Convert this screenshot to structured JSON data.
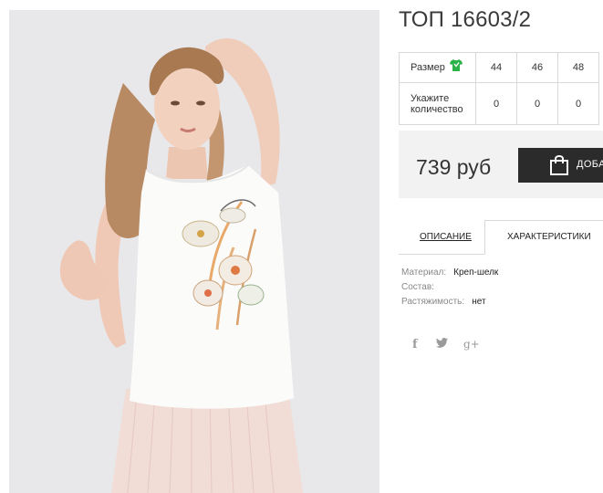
{
  "product": {
    "title": "ТОП 16603/2",
    "image_alt": "Model wearing white sleeveless top with flower print and pink pleated skirt"
  },
  "sizes": {
    "size_label": "Размер",
    "quantity_label_line1": "Укажите",
    "quantity_label_line2": "количество",
    "options": [
      {
        "size": "44",
        "qty": "0"
      },
      {
        "size": "46",
        "qty": "0"
      },
      {
        "size": "48",
        "qty": "0"
      }
    ],
    "icon": "tshirt-icon",
    "icon_color": "#2bb34a"
  },
  "purchase": {
    "price": "739 руб",
    "add_button_label": "ДОБА",
    "button_icon": "shopping-bag-icon",
    "button_color": "#2b2b2b"
  },
  "tabs": [
    {
      "label": "ОПИСАНИЕ",
      "active": false
    },
    {
      "label": "ХАРАКТЕРИСТИКИ",
      "active": true
    }
  ],
  "specs": [
    {
      "key": "Материал:",
      "value": "Креп-шелк"
    },
    {
      "key": "Состав:",
      "value": ""
    },
    {
      "key": "Растяжимость:",
      "value": "нет"
    }
  ],
  "social": {
    "facebook": "f",
    "twitter": "twitter-icon",
    "google_plus": "g+"
  }
}
